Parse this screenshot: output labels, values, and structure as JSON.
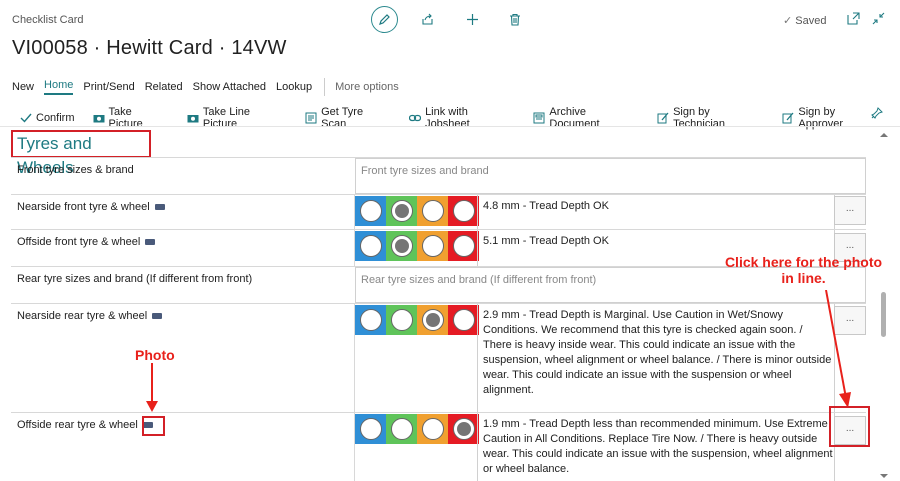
{
  "header": {
    "app_title": "Checklist Card",
    "card_title": "VI00058 · Hewitt Card · 14VW",
    "saved_label": "Saved"
  },
  "menu": {
    "items": [
      "New",
      "Home",
      "Print/Send",
      "Related",
      "Show Attached",
      "Lookup"
    ],
    "more": "More options"
  },
  "actions": [
    "Confirm",
    "Take Picture",
    "Take Line Picture",
    "Get Tyre Scan",
    "Link with Jobsheet",
    "Archive Document",
    "Sign by Technician",
    "Sign by Approver"
  ],
  "section": {
    "title": "Tyres and Wheels"
  },
  "rows": [
    {
      "label": "Front tyre sizes & brand",
      "placeholder": "Front tyre sizes and brand"
    },
    {
      "label": "Nearside front tyre & wheel",
      "note": "4.8 mm - Tread Depth OK",
      "selected": "green"
    },
    {
      "label": "Offside front tyre & wheel",
      "note": "5.1 mm - Tread Depth OK",
      "selected": "green"
    },
    {
      "label": "Rear tyre sizes and brand (If different from front)",
      "placeholder": "Rear tyre sizes and brand (If different from front)"
    },
    {
      "label": "Nearside rear tyre & wheel",
      "note": "2.9 mm - Tread Depth is Marginal. Use Caution in Wet/Snowy Conditions. We recommend that this tyre is checked again soon. / There is heavy inside wear. This could indicate an issue with the suspension, wheel alignment or wheel balance. / There is minor outside wear. This could indicate an issue with the suspension or wheel alignment.",
      "selected": "orange"
    },
    {
      "label": "Offside rear tyre & wheel",
      "note": "1.9 mm - Tread Depth less than recommended minimum. Use Extreme Caution in All Conditions. Replace Tire Now. / There is heavy outside wear. This could indicate an issue with the suspension, wheel alignment or wheel balance.",
      "selected": "red"
    }
  ],
  "ellipsis": "...",
  "annotations": {
    "photo": "Photo",
    "click_here_1": "Click here for the photo",
    "click_here_2": "in line."
  },
  "colors": {
    "accent": "#1e7a82",
    "light_blue": "#2f8fd6",
    "light_green": "#5fc45a",
    "light_orange": "#f0a030",
    "light_red": "#e51b24",
    "annotation_red": "#e8211b"
  },
  "icons": [
    "edit-icon",
    "share-icon",
    "plus-icon",
    "delete-icon",
    "check-icon",
    "popout-icon",
    "collapse-icon",
    "pin-icon",
    "camera-icon"
  ]
}
